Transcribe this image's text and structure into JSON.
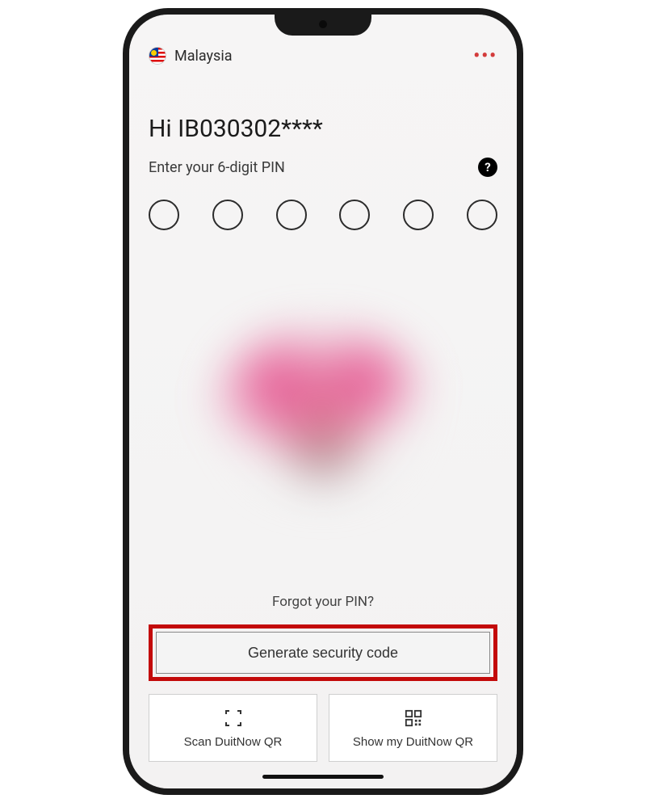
{
  "header": {
    "country": "Malaysia"
  },
  "greeting": "Hi IB030302****",
  "pin": {
    "label": "Enter your 6-digit PIN",
    "digits": 6
  },
  "forgot_label": "Forgot your PIN?",
  "buttons": {
    "generate": "Generate security code",
    "scan_qr": "Scan DuitNow QR",
    "show_qr": "Show my DuitNow QR"
  }
}
